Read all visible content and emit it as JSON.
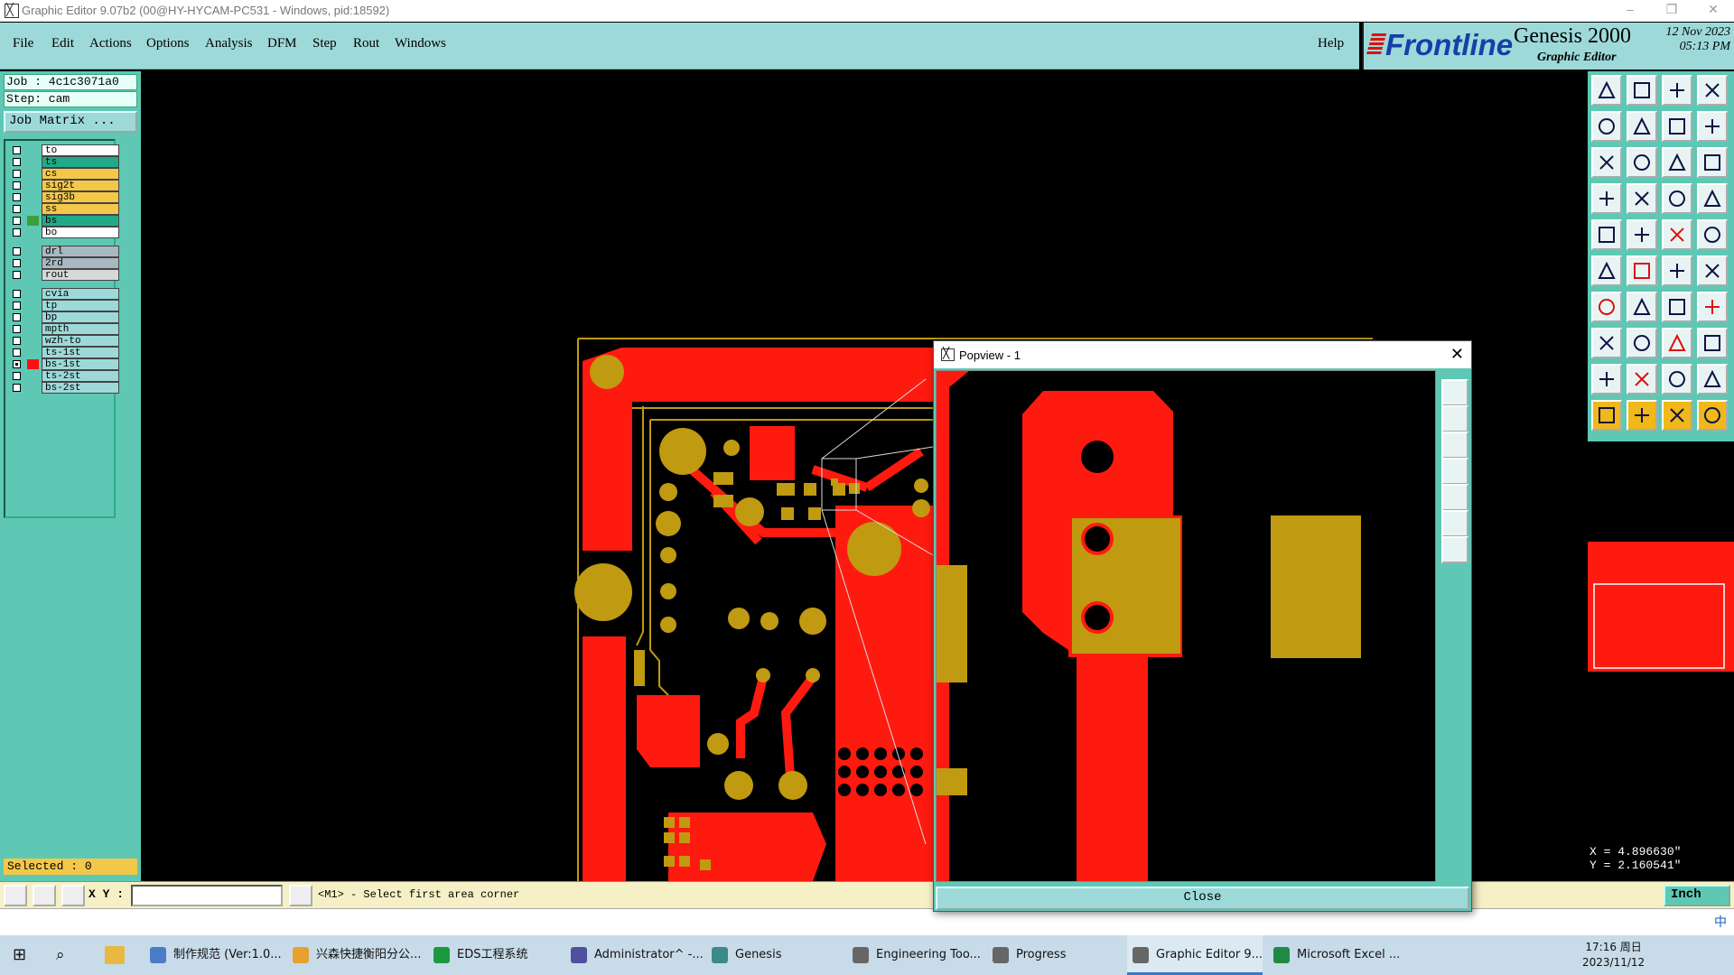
{
  "window": {
    "title": "Graphic Editor 9.07b2 (00@HY-HYCAM-PC531 - Windows, pid:18592)",
    "controls": [
      "–",
      "❐",
      "✕"
    ]
  },
  "menu": {
    "items": [
      "File",
      "Edit",
      "Actions",
      "Options",
      "Analysis",
      "DFM",
      "Step",
      "Rout",
      "Windows"
    ],
    "help": "Help"
  },
  "brand": {
    "logo": "Frontline",
    "product": "Genesis 2000",
    "subtitle": "Graphic Editor",
    "date_line1": "12 Nov 2023",
    "date_line2": "05:13 PM"
  },
  "job": {
    "job_label": "Job : 4c1c3071a0",
    "step_label": "Step: cam",
    "matrix_button": "Job Matrix ..."
  },
  "layers": [
    {
      "name": "to",
      "color": "#ffffff",
      "swatch": "",
      "checked": false
    },
    {
      "name": "ts",
      "color": "#22aa88",
      "swatch": "",
      "checked": false
    },
    {
      "name": "cs",
      "color": "#f3c84a",
      "swatch": "",
      "checked": false
    },
    {
      "name": "sig2t",
      "color": "#f3c84a",
      "swatch": "",
      "checked": false
    },
    {
      "name": "sig3b",
      "color": "#f3c84a",
      "swatch": "",
      "checked": false
    },
    {
      "name": "ss",
      "color": "#f3c84a",
      "swatch": "",
      "checked": false
    },
    {
      "name": "bs",
      "color": "#22aa88",
      "swatch": "#3ca03c",
      "checked": false
    },
    {
      "name": "bo",
      "color": "#ffffff",
      "swatch": "",
      "checked": false
    },
    {
      "name": "drl",
      "color": "#a8b8c0",
      "swatch": "",
      "checked": false
    },
    {
      "name": "2rd",
      "color": "#a8b8c0",
      "swatch": "",
      "checked": false
    },
    {
      "name": "rout",
      "color": "#d8d8d8",
      "swatch": "",
      "checked": false
    },
    {
      "name": "cvia",
      "color": "#9ed9d9",
      "swatch": "",
      "checked": false
    },
    {
      "name": "tp",
      "color": "#9ed9d9",
      "swatch": "",
      "checked": false
    },
    {
      "name": "bp",
      "color": "#9ed9d9",
      "swatch": "",
      "checked": false
    },
    {
      "name": "mpth",
      "color": "#9ed9d9",
      "swatch": "",
      "checked": false
    },
    {
      "name": "wzh-to",
      "color": "#9ed9d9",
      "swatch": "",
      "checked": false
    },
    {
      "name": "ts-1st",
      "color": "#9ed9d9",
      "swatch": "",
      "checked": false
    },
    {
      "name": "bs-1st",
      "color": "#9ed9d9",
      "swatch": "#ff1010",
      "checked": true
    },
    {
      "name": "ts-2st",
      "color": "#9ed9d9",
      "swatch": "",
      "checked": false
    },
    {
      "name": "bs-2st",
      "color": "#9ed9d9",
      "swatch": "",
      "checked": false
    }
  ],
  "selected_label": "Selected : 0",
  "command": {
    "xy_label": "X Y :",
    "xy_value": "",
    "prompt": "<M1> - Select first area corner",
    "unit": "Inch"
  },
  "coords": {
    "x": "X = 4.896630\"",
    "y": "Y = 2.160541\""
  },
  "popview": {
    "title": "Popview - 1",
    "close_button": "Close"
  },
  "colors": {
    "copper": "#ff1a10",
    "pad": "#c09a10",
    "panel": "#5ec8b4",
    "menu": "#9ed9d9"
  },
  "taskbar": {
    "items": [
      {
        "label": "制作规范 (Ver:1.0...",
        "icon": "document-icon"
      },
      {
        "label": "兴森快捷衡阳分公...",
        "icon": "browser-icon"
      },
      {
        "label": "EDS工程系统",
        "icon": "eds-icon"
      },
      {
        "label": "Administrator^ -...",
        "icon": "save-icon"
      },
      {
        "label": "Genesis",
        "icon": "genesis-icon"
      },
      {
        "label": "Engineering Too...",
        "icon": "app-icon"
      },
      {
        "label": "Progress",
        "icon": "app-icon"
      },
      {
        "label": "Graphic Editor 9...",
        "icon": "app-icon"
      },
      {
        "label": "Microsoft Excel ...",
        "icon": "excel-icon"
      }
    ],
    "ime": "中",
    "time": "17:16 周日",
    "date": "2023/11/12"
  }
}
